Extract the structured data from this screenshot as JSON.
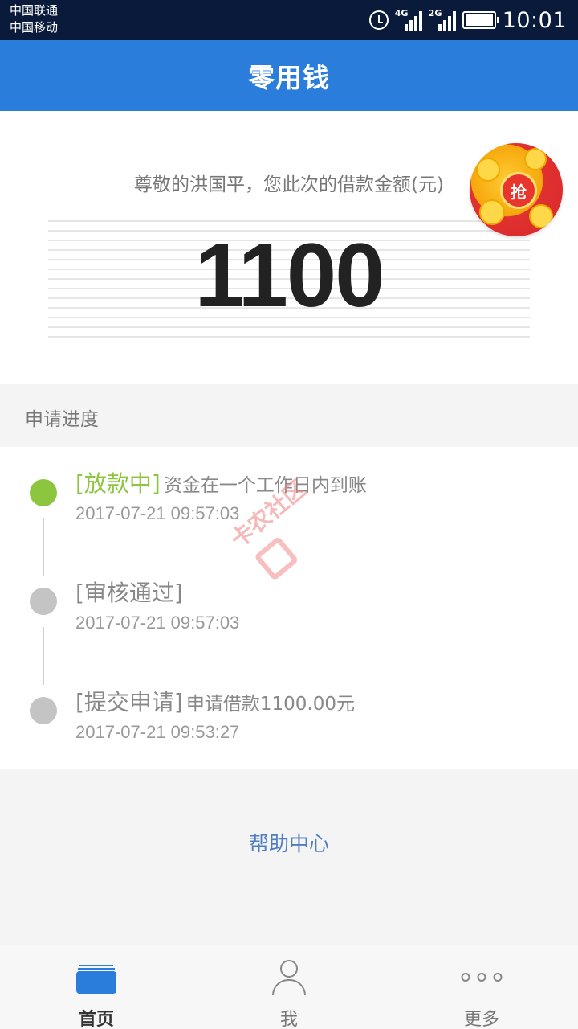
{
  "status_bar": {
    "carrier_1": "中国联通",
    "carrier_2": "中国移动",
    "network_1": "4G",
    "network_2": "2G",
    "time": "10:01",
    "icons": [
      "alarm-icon",
      "signal-icon",
      "battery-icon"
    ]
  },
  "header": {
    "title": "零用钱"
  },
  "amount_card": {
    "greeting": "尊敬的洪国平，您此次的借款金额(元)",
    "amount": "1100",
    "badge_label": "抢"
  },
  "progress": {
    "section_label": "申请进度",
    "steps": [
      {
        "tag": "[放款中]",
        "desc": "资金在一个工作日内到账",
        "time": "2017-07-21 09:57:03",
        "status": "active"
      },
      {
        "tag": "[审核通过]",
        "desc": "",
        "time": "2017-07-21 09:57:03",
        "status": "done"
      },
      {
        "tag": "[提交申请]",
        "desc": "申请借款1100.00元",
        "time": "2017-07-21 09:53:27",
        "status": "done"
      }
    ]
  },
  "help": {
    "label": "帮助中心"
  },
  "bottom_nav": {
    "items": [
      {
        "label": "首页",
        "icon": "home-icon",
        "active": true
      },
      {
        "label": "我",
        "icon": "person-icon",
        "active": false
      },
      {
        "label": "更多",
        "icon": "more-icon",
        "active": false
      }
    ]
  },
  "watermark": {
    "text": "卡农社区"
  },
  "colors": {
    "primary": "#2b7ddb",
    "active_green": "#8cc63f",
    "link_blue": "#4e7ec1",
    "status_bar": "#0a1a3a"
  }
}
